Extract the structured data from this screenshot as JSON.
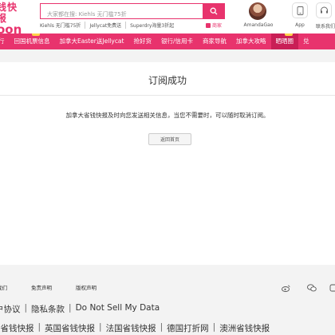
{
  "header": {
    "logo_line1": "钱快报",
    "logo_line2": "oon",
    "search_placeholder": "大家都在搜: Kiehls 无门槛75折",
    "hotwords": [
      "Kiehls 无门槛75折",
      "Jellycat免费送",
      "Superdry海量3折起"
    ],
    "merchant_label": "商家",
    "username": "AmandaGao",
    "app_label": "App",
    "cs_label": "联系我们"
  },
  "nav": {
    "items": [
      {
        "label": "行",
        "active": false
      },
      {
        "label": "回国机票信息",
        "active": false
      },
      {
        "label": "加拿大Easter送Jellycat",
        "active": false
      },
      {
        "label": "抢好货",
        "active": false
      },
      {
        "label": "银行/信用卡",
        "active": false
      },
      {
        "label": "商家导航",
        "active": false
      },
      {
        "label": "加拿大攻略",
        "active": false
      },
      {
        "label": "晒晒圈",
        "active": true
      },
      {
        "label": "兑",
        "active": false
      }
    ]
  },
  "main": {
    "title": "订阅成功",
    "message": "加拿大省钱快报及时向您发送相关信息，当您不需要时，可以随时取消订阅。",
    "home_button": "返回首页"
  },
  "footer": {
    "links": [
      "我们",
      "免责声明",
      "版权声明"
    ],
    "legal": [
      "户协议",
      "隐私条款",
      "Do Not Sell My Data"
    ],
    "sites": [
      "美省钱快报",
      "英国省钱快报",
      "法国省钱快报",
      "德国打折网",
      "澳洲省钱快报"
    ]
  },
  "colors": {
    "brand": "#e8336d",
    "nav_active": "#c91f56",
    "badge": "#ffd24a"
  }
}
